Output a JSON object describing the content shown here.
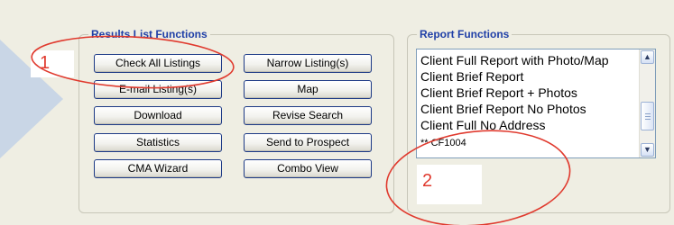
{
  "results_group": {
    "title": "Results List Functions",
    "buttons": {
      "check_all": "Check All Listings",
      "narrow": "Narrow Listing(s)",
      "email": "E-mail Listing(s)",
      "map": "Map",
      "download": "Download",
      "revise": "Revise Search",
      "statistics": "Statistics",
      "send": "Send to Prospect",
      "cma": "CMA Wizard",
      "combo": "Combo View"
    }
  },
  "report_group": {
    "title": "Report Functions",
    "list_items": [
      "Client Full Report with Photo/Map",
      "Client Brief Report",
      "Client Brief Report + Photos",
      "Client Brief Report No Photos",
      "Client Full No Address",
      "** CF1004"
    ]
  },
  "annotations": {
    "label_1": "1",
    "label_2": "2",
    "color": "#e03a2e"
  },
  "icons": {
    "scroll_up": "▲",
    "scroll_down": "▼"
  }
}
